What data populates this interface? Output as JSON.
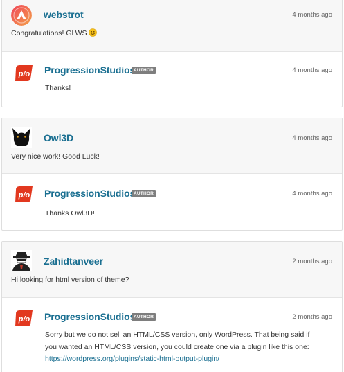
{
  "threads": [
    {
      "comment": {
        "author": "webstrot",
        "time": "4 months ago",
        "text": "Congratulations! GLWS",
        "emoji": "smiley-emoji"
      },
      "reply": {
        "author": "ProgressionStudios",
        "badge": "AUTHOR",
        "time": "4 months ago",
        "text": "Thanks!"
      }
    },
    {
      "comment": {
        "author": "Owl3D",
        "time": "4 months ago",
        "text": "Very nice work! Good Luck!"
      },
      "reply": {
        "author": "ProgressionStudios",
        "badge": "AUTHOR",
        "time": "4 months ago",
        "text": "Thanks Owl3D!"
      }
    },
    {
      "comment": {
        "author": "Zahidtanveer",
        "time": "2 months ago",
        "text": "Hi looking for html version of theme?"
      },
      "reply": {
        "author": "ProgressionStudios",
        "badge": "AUTHOR",
        "time": "2 months ago",
        "text_line1": "Sorry but we do not sell an HTML/CSS version, only WordPress. That being said if",
        "text_line2": "you wanted an HTML/CSS version, you could create one via a plugin like this one:",
        "link": "https://wordpress.org/plugins/static-html-output-plugin/"
      }
    }
  ],
  "colors": {
    "link": "#1a6f91",
    "badge": "#7e7e7e",
    "ps_red": "#e2381f",
    "webstrot_gradient": [
      "#f0445a",
      "#f3a148"
    ]
  }
}
